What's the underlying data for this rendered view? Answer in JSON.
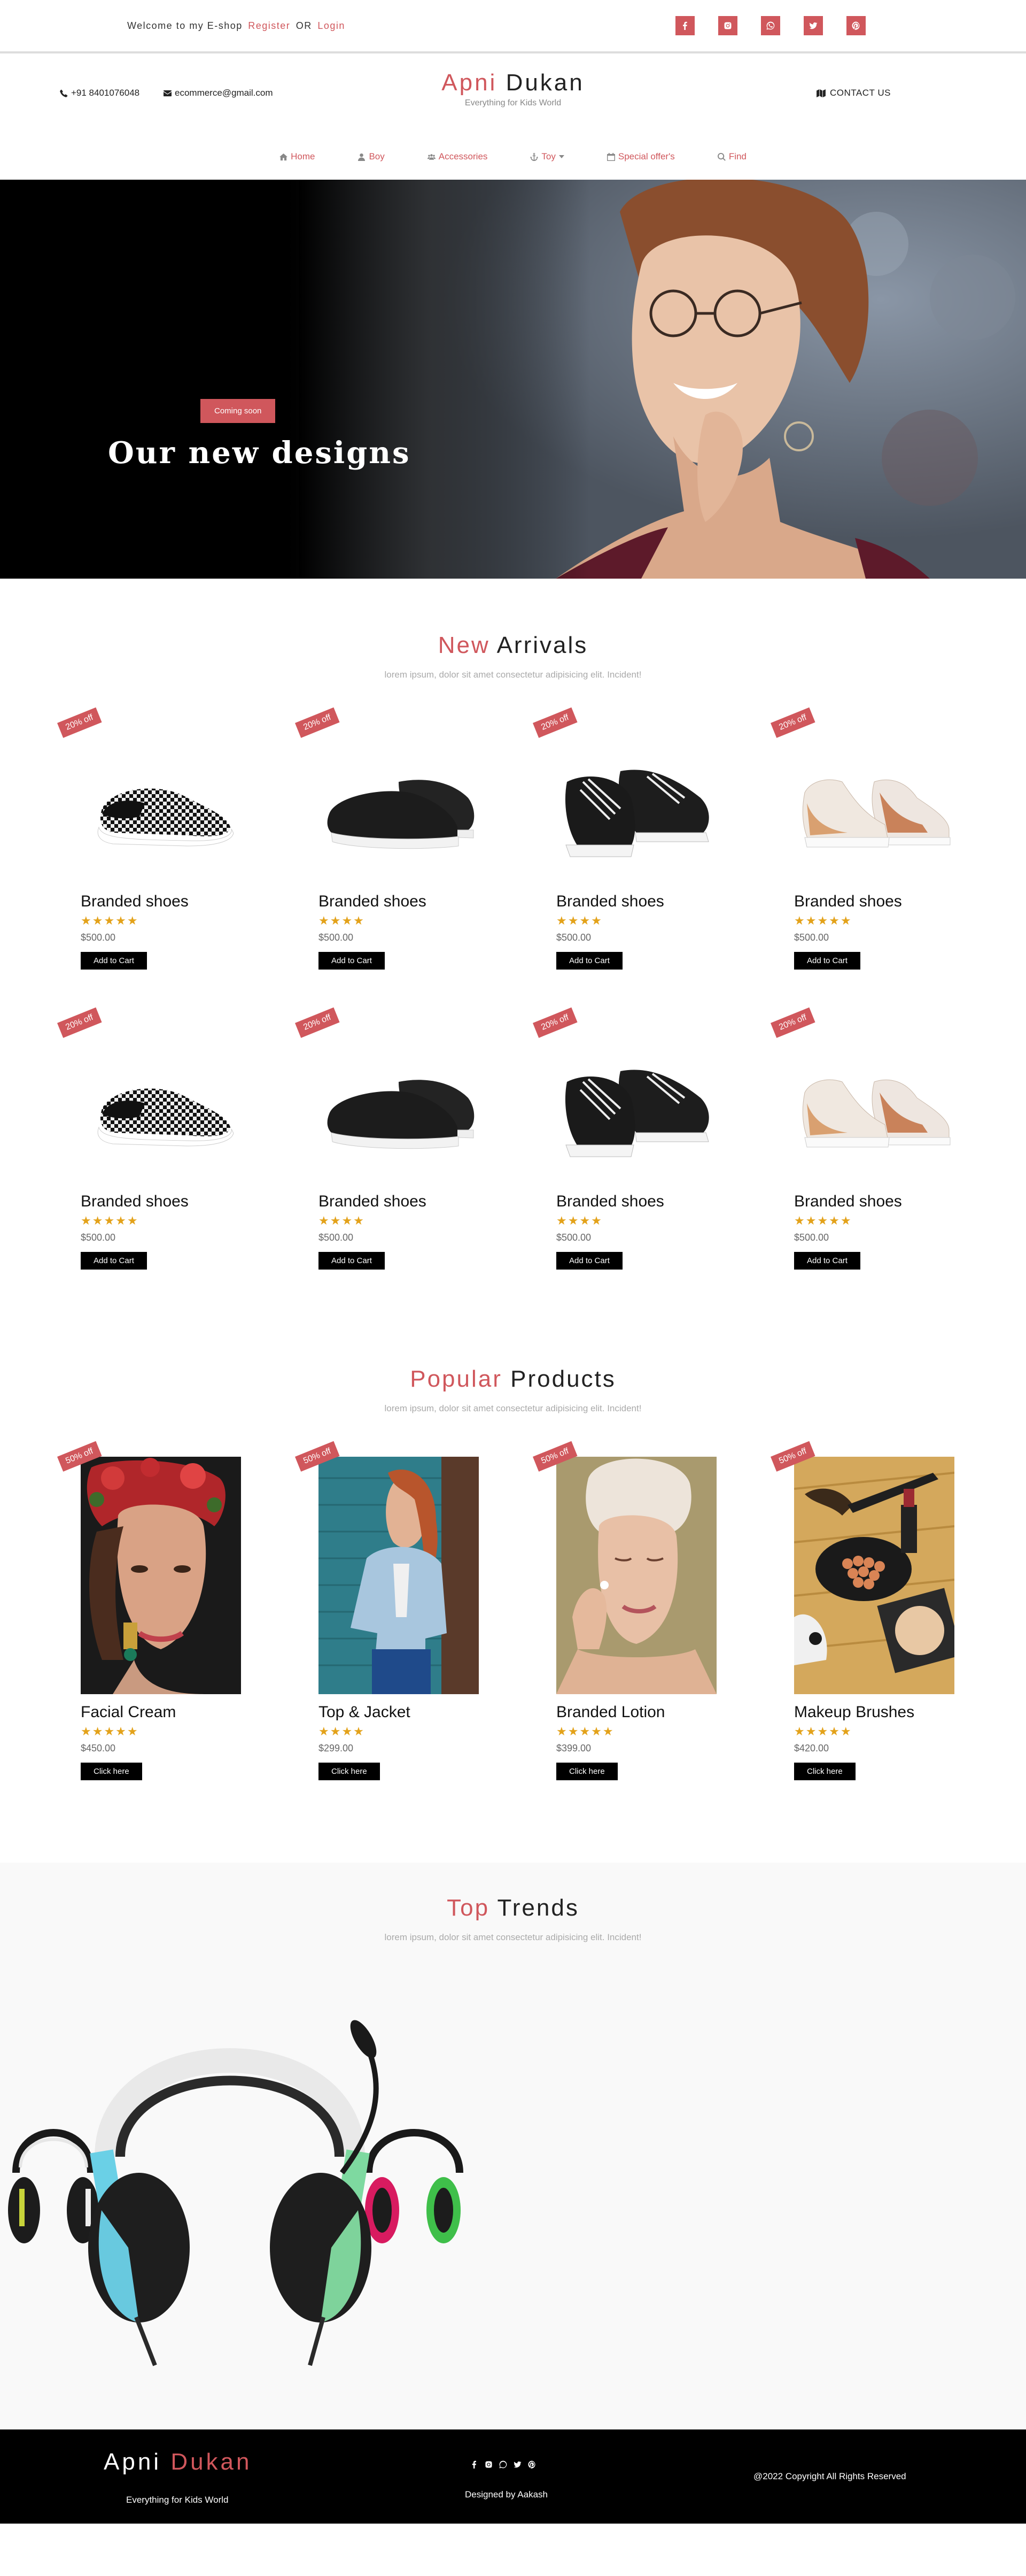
{
  "topbar": {
    "welcome": "Welcome to my E-shop",
    "register": "Register",
    "or": "OR",
    "login": "Login",
    "socials": [
      "facebook-icon",
      "instagram-icon",
      "whatsapp-icon",
      "twitter-icon",
      "pinterest-icon"
    ]
  },
  "header": {
    "phone": "+91 8401076048",
    "email": "ecommerce@gmail.com",
    "brand_first": "Apni",
    "brand_second": "Dukan",
    "tagline": "Everything for Kids World",
    "contact": "CONTACT US"
  },
  "nav": {
    "home": "Home",
    "boy": "Boy",
    "accessories": "Accessories",
    "toy": "Toy",
    "special": "Special offer's",
    "find": "Find"
  },
  "hero": {
    "badge": "Coming soon",
    "headline": "Our new designs"
  },
  "arrivals": {
    "title_accent": "New",
    "title_rest": "Arrivals",
    "subtitle": "lorem ipsum, dolor sit amet consectetur adipisicing elit. Incident!",
    "items": [
      {
        "ribbon": "20% off",
        "title": "Branded shoes",
        "stars": "★★★★★",
        "price": "$500.00",
        "button": "Add to Cart"
      },
      {
        "ribbon": "20% off",
        "title": "Branded shoes",
        "stars": "★★★★",
        "price": "$500.00",
        "button": "Add to Cart"
      },
      {
        "ribbon": "20% off",
        "title": "Branded shoes",
        "stars": "★★★★",
        "price": "$500.00",
        "button": "Add to Cart"
      },
      {
        "ribbon": "20% off",
        "title": "Branded shoes",
        "stars": "★★★★★",
        "price": "$500.00",
        "button": "Add to Cart"
      },
      {
        "ribbon": "20% off",
        "title": "Branded shoes",
        "stars": "★★★★★",
        "price": "$500.00",
        "button": "Add to Cart"
      },
      {
        "ribbon": "20% off",
        "title": "Branded shoes",
        "stars": "★★★★",
        "price": "$500.00",
        "button": "Add to Cart"
      },
      {
        "ribbon": "20% off",
        "title": "Branded shoes",
        "stars": "★★★★",
        "price": "$500.00",
        "button": "Add to Cart"
      },
      {
        "ribbon": "20% off",
        "title": "Branded shoes",
        "stars": "★★★★★",
        "price": "$500.00",
        "button": "Add to Cart"
      }
    ]
  },
  "popular": {
    "title_accent": "Popular",
    "title_rest": "Products",
    "subtitle": "lorem ipsum, dolor sit amet consectetur adipisicing elit. Incident!",
    "items": [
      {
        "ribbon": "50% off",
        "title": "Facial Cream",
        "stars": "★★★★★",
        "price": "$450.00",
        "button": "Click here"
      },
      {
        "ribbon": "50% off",
        "title": "Top & Jacket",
        "stars": "★★★★",
        "price": "$299.00",
        "button": "Click here"
      },
      {
        "ribbon": "50% off",
        "title": "Branded Lotion",
        "stars": "★★★★★",
        "price": "$399.00",
        "button": "Click here"
      },
      {
        "ribbon": "50% off",
        "title": "Makeup Brushes",
        "stars": "★★★★★",
        "price": "$420.00",
        "button": "Click here"
      }
    ]
  },
  "trends": {
    "title_accent": "Top",
    "title_rest": "Trends",
    "subtitle": "lorem ipsum, dolor sit amet consectetur adipisicing elit. Incident!"
  },
  "footer": {
    "brand_first": "Apni",
    "brand_second": "Dukan",
    "tagline": "Everything for Kids World",
    "designed": "Designed by Aakash",
    "copyright": "@2022 Copyright All Rights Reserved"
  },
  "colors": {
    "accent": "#d0575c",
    "star": "#e3a21a",
    "dark": "#000000"
  }
}
